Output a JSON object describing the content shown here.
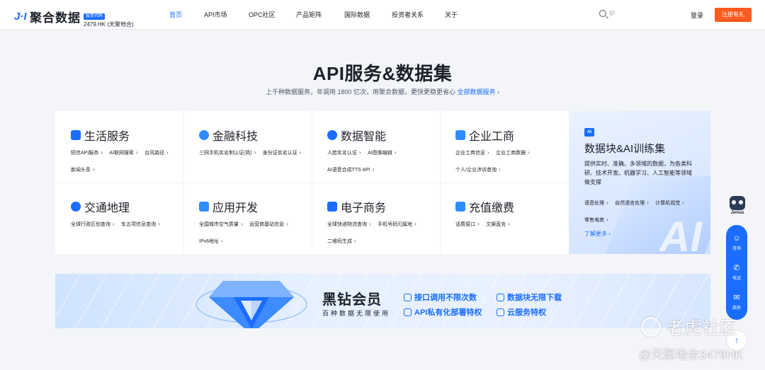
{
  "header": {
    "logo_text": "聚合数据",
    "stock_badge": "股票代码",
    "stock_code": "2479.HK (天聚地合)",
    "nav": [
      {
        "label": "首页",
        "active": true
      },
      {
        "label": "API市场",
        "active": false
      },
      {
        "label": "OPC社区",
        "active": false
      },
      {
        "label": "产品矩阵",
        "active": false
      },
      {
        "label": "国际数据",
        "active": false
      },
      {
        "label": "投资者关系",
        "active": false
      },
      {
        "label": "关于",
        "active": false
      }
    ],
    "search_placeholder": "IP",
    "login_label": "登录",
    "register_label": "注册有礼"
  },
  "hero": {
    "title": "API服务&数据集",
    "subtitle": "上千种数据服务，年调用 1800 亿次，用聚合数据，更快更稳更省心",
    "link": "全部数据服务",
    "link_chevron": "›"
  },
  "categories": [
    {
      "title": "生活服务",
      "icon": "life-service-icon",
      "color": "#1a6dff",
      "tags": [
        "短信API服务",
        "AI联网搜索",
        "台风路径",
        "新闻头条"
      ]
    },
    {
      "title": "金融科技",
      "icon": "fintech-icon",
      "color": "#2f8cff",
      "tags": [
        "三网手机实名制认证(简)",
        "身份证实名认证"
      ]
    },
    {
      "title": "数据智能",
      "icon": "data-intelligence-icon",
      "color": "#1a6dff",
      "tags": [
        "人脸实名认证",
        "AI图像编辑",
        "AI语音合成TTS API"
      ]
    },
    {
      "title": "企业工商",
      "icon": "enterprise-icon",
      "color": "#2f8cff",
      "tags": [
        "企业工商信息",
        "企业工商数据",
        "个人/企业涉诉查询"
      ]
    },
    {
      "title": "交通地理",
      "icon": "transport-icon",
      "color": "#1a6dff",
      "tags": [
        "全球行政区划查询",
        "车五项信息查询"
      ]
    },
    {
      "title": "应用开发",
      "icon": "app-dev-icon",
      "color": "#2f8cff",
      "tags": [
        "全国城市空气质量",
        "运营商基站信息",
        "IPv6地址"
      ]
    },
    {
      "title": "电子商务",
      "icon": "ecommerce-icon",
      "color": "#1a6dff",
      "tags": [
        "全球快递物流查询",
        "手机号码归属地",
        "二维码生成"
      ]
    },
    {
      "title": "充值缴费",
      "icon": "payment-icon",
      "color": "#2f8cff",
      "tags": [
        "话费接口",
        "文娱直充"
      ]
    }
  ],
  "tag_chevron": "›",
  "special": {
    "badge": "AI",
    "title": "数据块&AI训练集",
    "description": "提供实时、准确、多领域的数据，为各类科研、技术开发、机器学习、人工智能等领域做支撑",
    "tags": [
      "语音处理",
      "自然语言处理",
      "计算机视觉",
      "零售电商"
    ],
    "more": "了解更多",
    "big_text": "AI"
  },
  "banner": {
    "title": "黑钻会员",
    "subtitle": "百种数据无限使用",
    "features": [
      "接口调用不限次数",
      "数据块无限下载",
      "API私有化部署特权",
      "云服务特权"
    ]
  },
  "side": {
    "mascot_label": "Jenius",
    "items": [
      {
        "label": "咨询",
        "glyph": "☺"
      },
      {
        "label": "电话",
        "glyph": "✆"
      },
      {
        "label": "商务",
        "glyph": "✉"
      }
    ],
    "back_top_glyph": "↑"
  },
  "watermark": {
    "line1": "老虎社区",
    "line2": "@天聚地合2479HK"
  },
  "colors": {
    "brand": "#1a6dff",
    "register": "#ff5a1f"
  }
}
